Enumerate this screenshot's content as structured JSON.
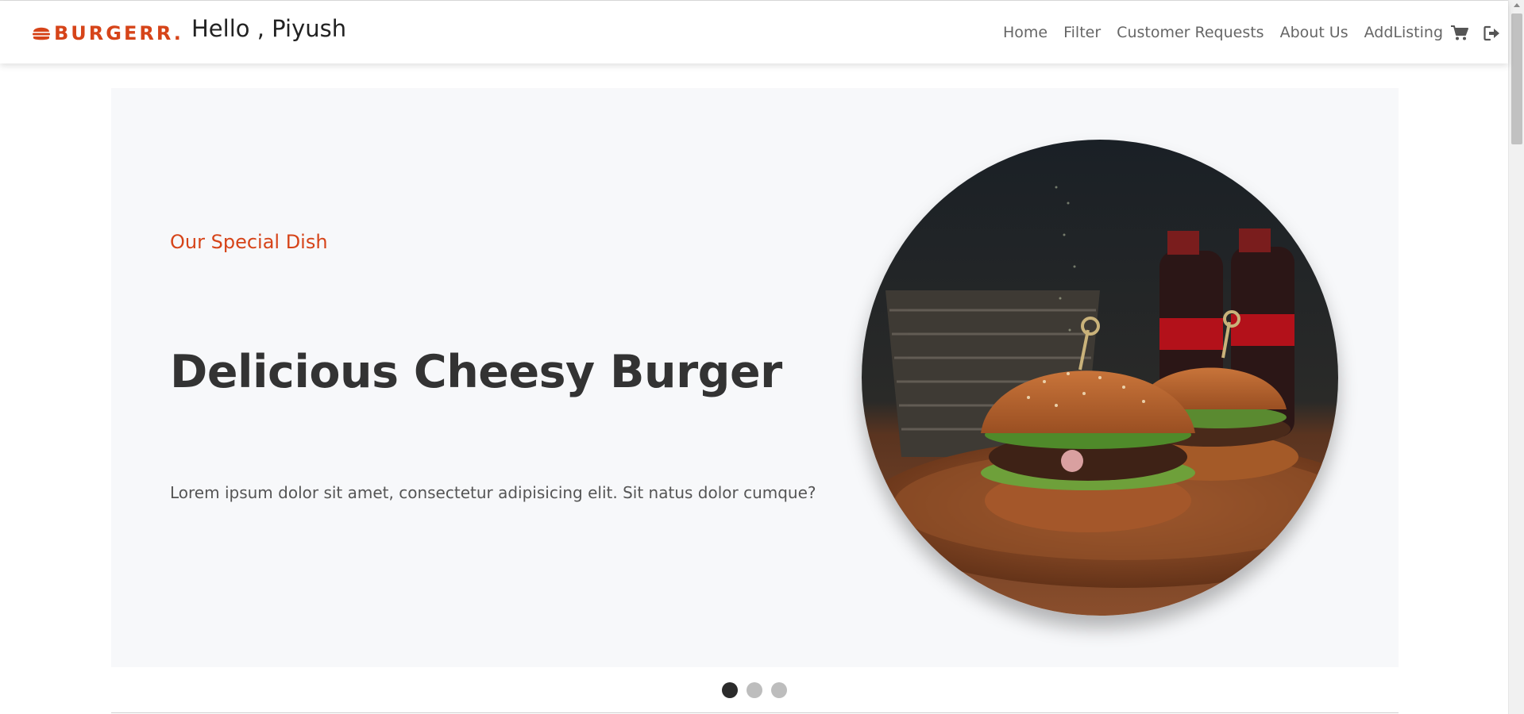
{
  "brand": {
    "logo_text": "BURGERR.",
    "logo_icon": "burger-icon",
    "accent_color": "#d64419"
  },
  "header": {
    "greeting": "Hello , Piyush"
  },
  "nav": {
    "items": [
      {
        "label": "Home"
      },
      {
        "label": "Filter"
      },
      {
        "label": "Customer Requests"
      },
      {
        "label": "About Us"
      },
      {
        "label": "AddListing"
      }
    ],
    "icons": [
      "cart-icon",
      "logout-icon"
    ]
  },
  "hero": {
    "subtitle": "Our Special Dish",
    "title": "Delicious Cheesy Burger",
    "description": "Lorem ipsum dolor sit amet, consectetur adipisicing elit. Sit natus dolor cumque?",
    "image": "burger-photo"
  },
  "carousel": {
    "slide_count": 3,
    "active_index": 0
  }
}
